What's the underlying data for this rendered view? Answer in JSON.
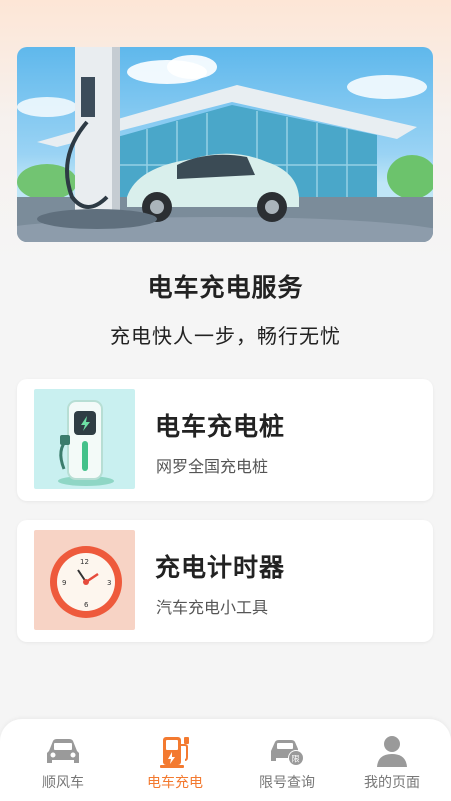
{
  "hero": {
    "image": "ev-charging-station-illustration"
  },
  "page": {
    "title": "电车充电服务",
    "subtitle": "充电快人一步，畅行无忧"
  },
  "cards": [
    {
      "title": "电车充电桩",
      "subtitle": "网罗全国充电桩",
      "icon": "charging-pile-icon"
    },
    {
      "title": "充电计时器",
      "subtitle": "汽车充电小工具",
      "icon": "alarm-clock-icon"
    }
  ],
  "tabbar": {
    "items": [
      {
        "label": "顺风车",
        "icon": "car-icon",
        "active": false
      },
      {
        "label": "电车充电",
        "icon": "charger-icon",
        "active": true
      },
      {
        "label": "限号查询",
        "icon": "restricted-car-icon",
        "active": false
      },
      {
        "label": "我的页面",
        "icon": "user-icon",
        "active": false
      }
    ],
    "active_color": "#f37a30",
    "inactive_color": "#777777"
  }
}
